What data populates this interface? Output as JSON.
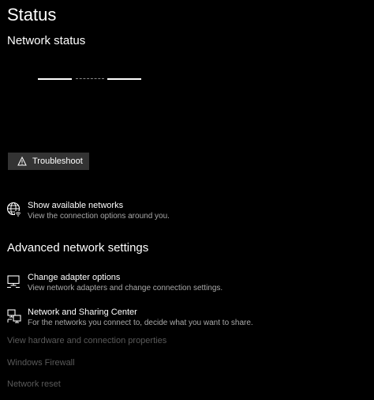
{
  "page": {
    "title": "Status"
  },
  "network_status": {
    "heading": "Network status",
    "troubleshoot_label": "Troubleshoot"
  },
  "links": {
    "show_networks": {
      "title": "Show available networks",
      "description": "View the connection options around you."
    }
  },
  "advanced": {
    "heading": "Advanced network settings",
    "items": [
      {
        "title": "Change adapter options",
        "description": "View network adapters and change connection settings.",
        "icon": "adapter-monitor-icon"
      },
      {
        "title": "Network and Sharing Center",
        "description": "For the networks you connect to, decide what you want to share.",
        "icon": "sharing-center-icon"
      }
    ],
    "disabled_links": [
      "View hardware and connection properties",
      "Windows Firewall",
      "Network reset"
    ]
  },
  "colors": {
    "background": "#000000",
    "text": "#ffffff",
    "description_text": "#a8a8a8",
    "disabled_text": "#5a5a5a",
    "button_bg": "#333333"
  }
}
